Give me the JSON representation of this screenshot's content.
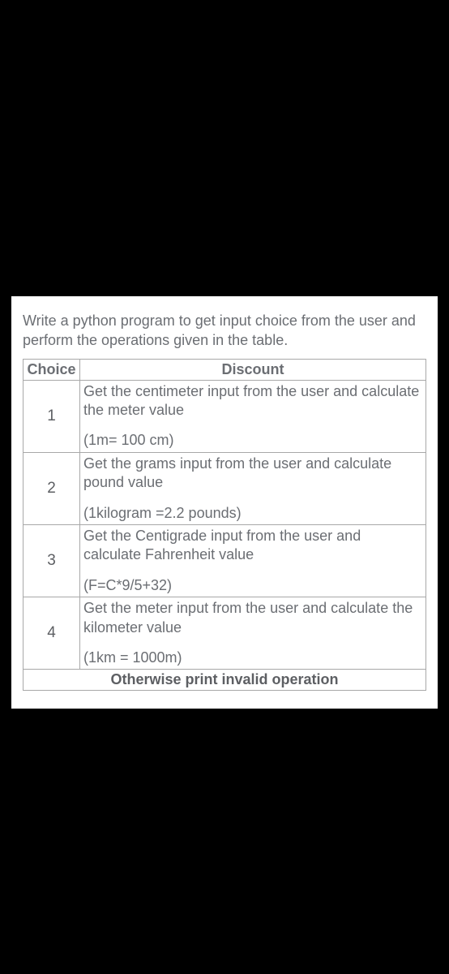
{
  "instruction": "Write a python program to get input choice from the user and perform the operations given in the table.",
  "table": {
    "headers": {
      "col1": "Choice",
      "col2": "Discount"
    },
    "rows": [
      {
        "num": "1",
        "main": "Get the centimeter input from the user and calculate the meter value",
        "formula": "(1m= 100 cm)"
      },
      {
        "num": "2",
        "main": "Get the grams input from the user and calculate pound value",
        "formula": "(1kilogram =2.2 pounds)"
      },
      {
        "num": "3",
        "main": "Get the Centigrade input from the user and calculate Fahrenheit value",
        "formula": "(F=C*9/5+32)"
      },
      {
        "num": "4",
        "main": "Get the meter input from the user and calculate the kilometer value",
        "formula": "(1km = 1000m)"
      }
    ],
    "otherwise": "Otherwise print invalid operation"
  }
}
